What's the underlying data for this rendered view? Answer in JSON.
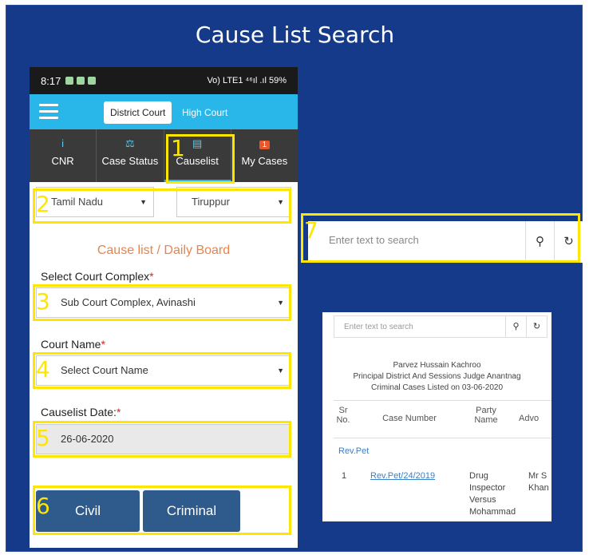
{
  "slide": {
    "title": "Cause List Search"
  },
  "phone": {
    "status": {
      "time": "8:17",
      "signal": "Vo) LTE1 ⁴⁶ıl .ıl 59%"
    },
    "header": {
      "district_tab": "District Court",
      "high_tab": "High Court"
    },
    "nav": [
      {
        "label": "CNR",
        "icon": "i"
      },
      {
        "label": "Case Status",
        "icon": "⚖"
      },
      {
        "label": "Causelist",
        "icon": "▤"
      },
      {
        "label": "My Cases",
        "badge": "1"
      }
    ],
    "state_select": "Tamil Nadu",
    "district_select": "Tiruppur",
    "heading": "Cause list / Daily Board",
    "court_complex_label": "Select Court Complex",
    "court_complex_value": "Sub Court Complex, Avinashi",
    "court_name_label": "Court Name",
    "court_name_value": "Select Court Name",
    "date_label": "Causelist Date:",
    "date_value": "26-06-2020",
    "civil_button": "Civil",
    "criminal_button": "Criminal",
    "required_mark": "*"
  },
  "callouts": [
    "1",
    "2",
    "3",
    "4",
    "5",
    "6",
    "7"
  ],
  "search": {
    "placeholder": "Enter text to search",
    "search_icon": "⚲",
    "reset_icon": "↻"
  },
  "result": {
    "placeholder": "Enter text to search",
    "judge_name": "Parvez Hussain Kachroo",
    "court": "Principal District And Sessions Judge Anantnag",
    "listed": "Criminal Cases Listed on 03-06-2020",
    "columns": [
      "Sr No.",
      "Case Number",
      "Party Name",
      "Advo"
    ],
    "category": "Rev.Pet",
    "row": {
      "sr": "1",
      "case_number": "Rev.Pet/24/2019",
      "party": "Drug Inspector Versus Mohammad",
      "advocate": "Mr S Khan"
    }
  },
  "colors": {
    "slide_bg": "#153a8a",
    "highlight": "#ffe600",
    "app_header": "#29b6e8",
    "button": "#2e5a8c"
  }
}
